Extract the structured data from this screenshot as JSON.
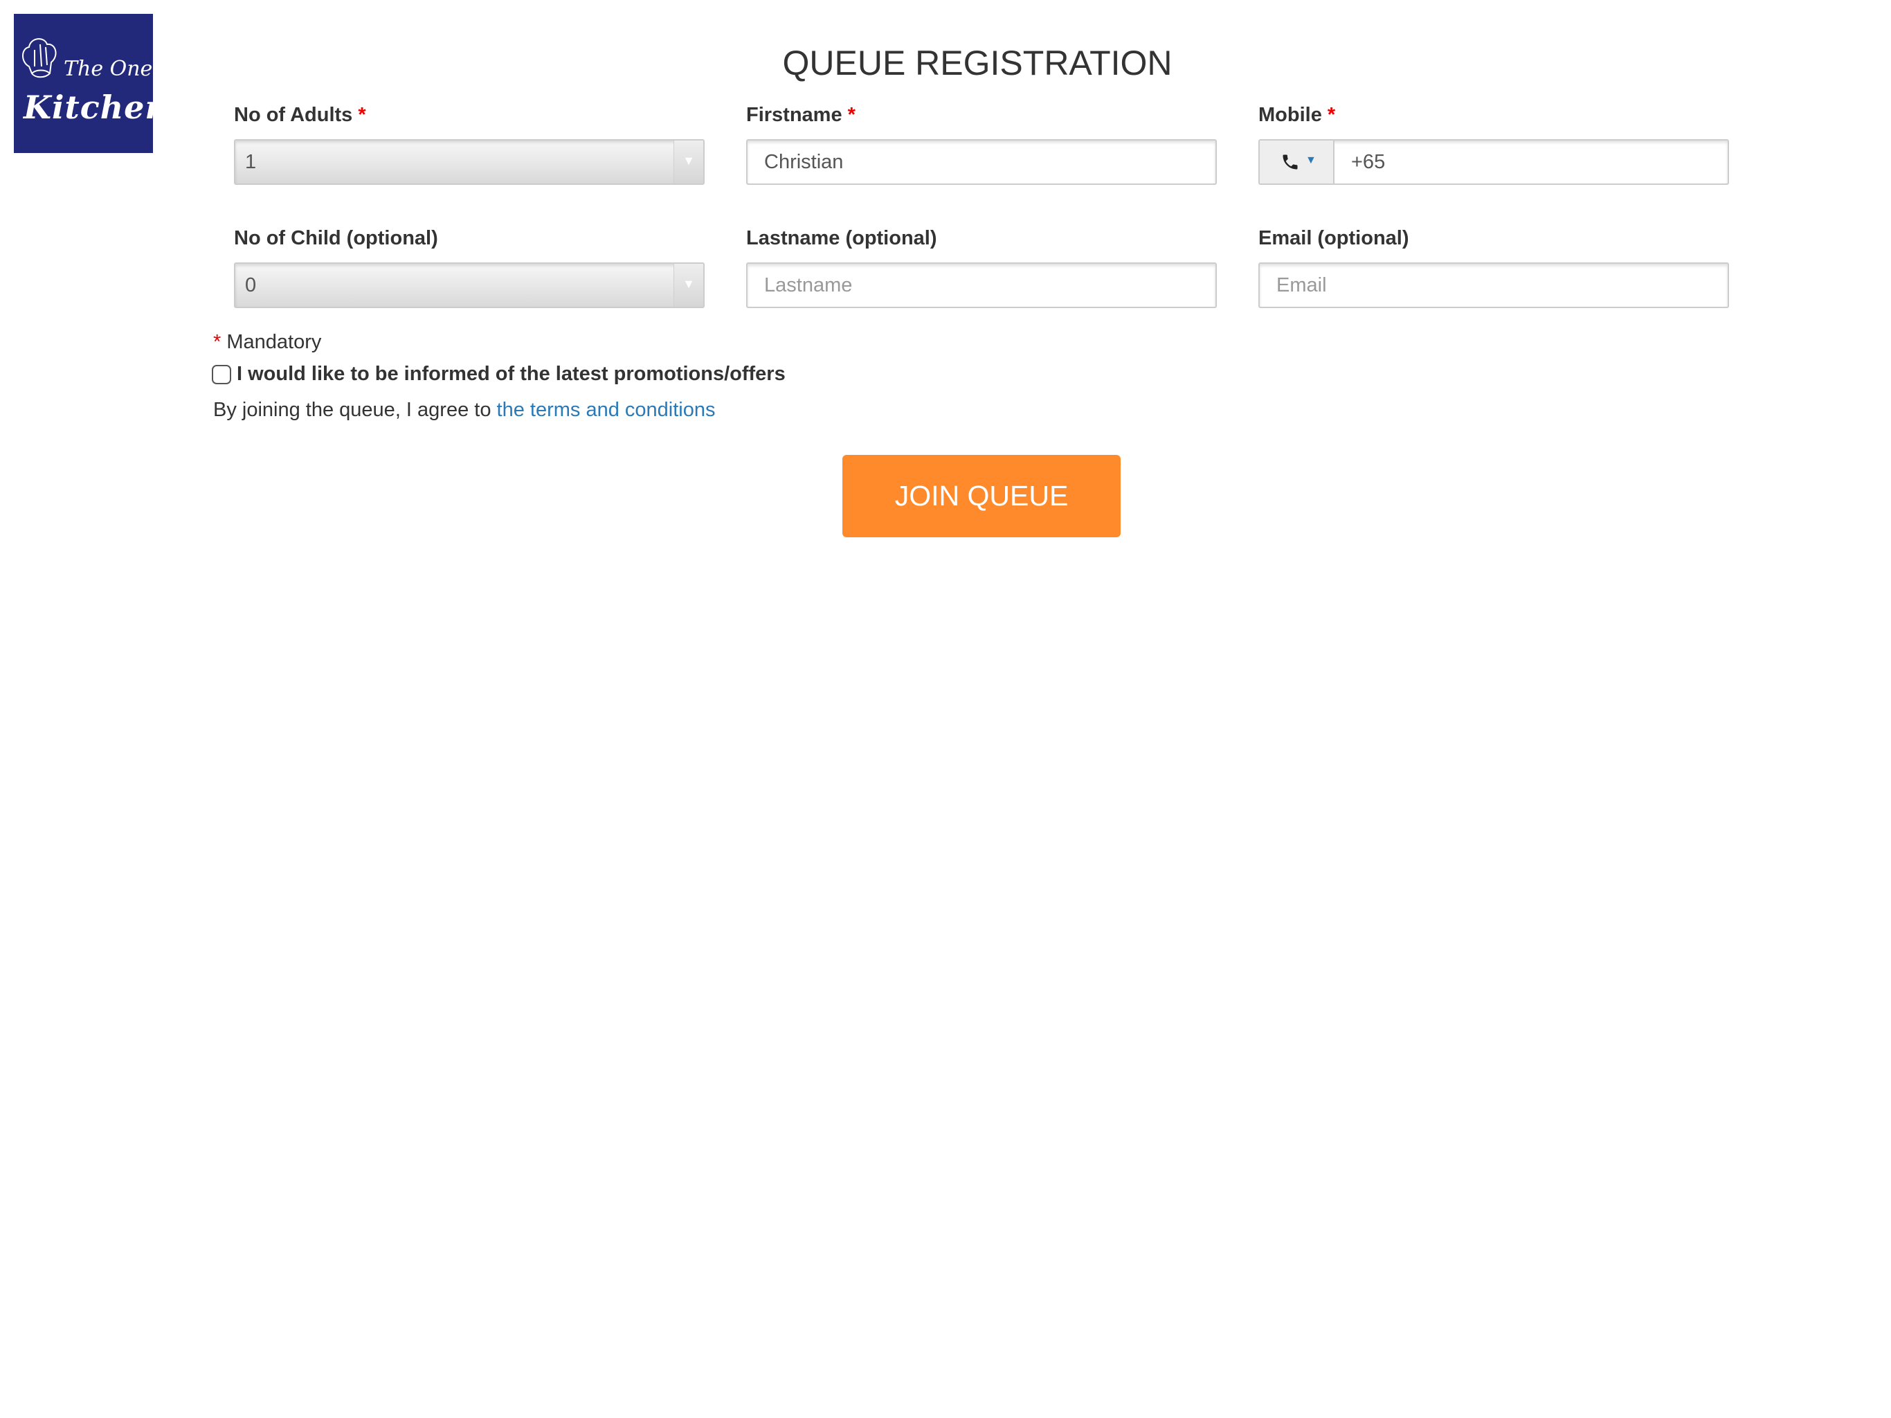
{
  "logo": {
    "line1": "The One",
    "line2": "Kitchen"
  },
  "title": "QUEUE REGISTRATION",
  "form": {
    "adults": {
      "label": "No of Adults",
      "required_mark": "*",
      "value": "1"
    },
    "firstname": {
      "label": "Firstname",
      "required_mark": "*",
      "value": "Christian"
    },
    "mobile": {
      "label": "Mobile",
      "required_mark": "*",
      "value": "+65",
      "addon_icon": "phone-icon"
    },
    "child": {
      "label": "No of Child (optional)",
      "value": "0"
    },
    "lastname": {
      "label": "Lastname (optional)",
      "placeholder": "Lastname"
    },
    "email": {
      "label": "Email (optional)",
      "placeholder": "Email"
    }
  },
  "mandatory_note": {
    "mark": "*",
    "text": "Mandatory"
  },
  "promo_checkbox": {
    "label": "I would like to be informed of the latest promotions/offers",
    "checked": false
  },
  "terms": {
    "prefix": "By joining the queue, I agree to ",
    "link": "the terms and conditions"
  },
  "join_button": {
    "label": "JOIN QUEUE",
    "color": "#ff8a2b"
  }
}
